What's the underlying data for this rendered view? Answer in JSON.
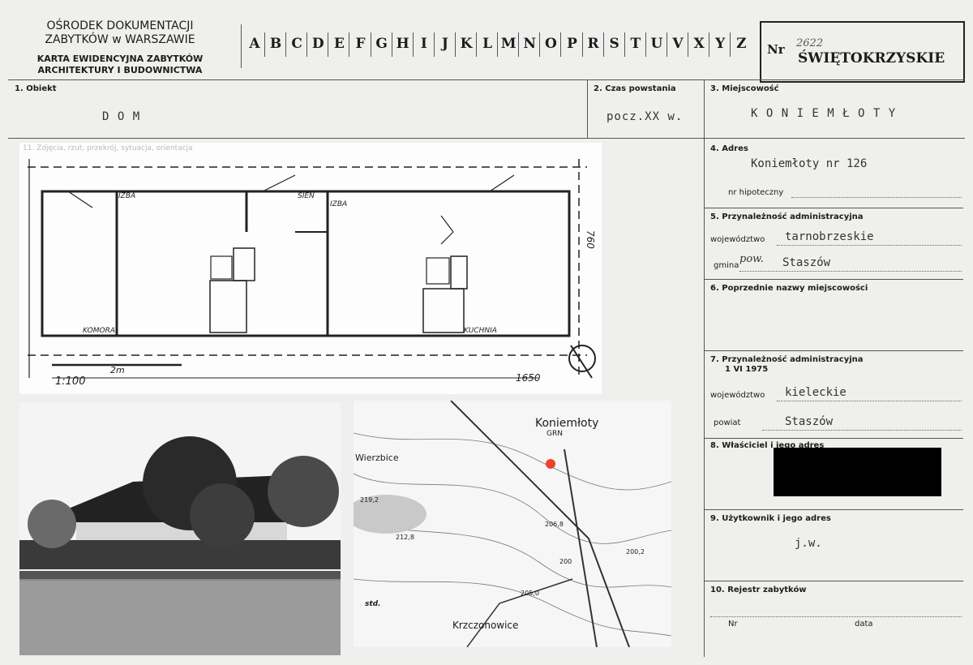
{
  "header": {
    "institution_line1": "OŚRODEK DOKUMENTACJI",
    "institution_line2": "ZABYTKÓW w WARSZAWIE",
    "card_line1": "KARTA EWIDENCYJNA ZABYTKÓW",
    "card_line2": "ARCHITEKTURY I BUDOWNICTWA",
    "letters": [
      "A",
      "B",
      "C",
      "D",
      "E",
      "F",
      "G",
      "H",
      "I",
      "J",
      "K",
      "L",
      "M",
      "N",
      "O",
      "P",
      "R",
      "S",
      "T",
      "U",
      "V",
      "X",
      "Y",
      "Z"
    ],
    "nr_label": "Nr",
    "nr_value": "2622",
    "region": "ŚWIĘTOKRZYSKIE"
  },
  "fields": {
    "obiekt_label": "1. Obiekt",
    "obiekt_value": "D O M",
    "czas_label": "2. Czas powstania",
    "czas_value": "pocz.XX w.",
    "miejscowosc_label": "3. Miejscowość",
    "miejscowosc_value": "K O N I E M Ł O T Y",
    "adres_label": "4. Adres",
    "adres_value": "Koniemłoty nr 126",
    "hipoteczny_label": "nr hipoteczny",
    "przynal_label": "5. Przynależność administracyjna",
    "woj_label": "województwo",
    "woj_value": "tarnobrzeskie",
    "gmina_label": "gmina",
    "gmina_hand": "pow.",
    "gmina_value": "Staszów",
    "poprz_label": "6. Poprzednie nazwy miejscowości",
    "przynal75_label": "7. Przynależność administracyjna",
    "przynal75_date": "1 VI 1975",
    "woj75_label": "województwo",
    "woj75_value": "kieleckie",
    "powiat_label": "powiat",
    "powiat_value": "Staszów",
    "wlasciciel_label": "8. Właściciel i jego adres",
    "uzytkownik_label": "9. Użytkownik i jego adres",
    "uzytkownik_value": "j.w.",
    "rejestr_label": "10. Rejestr zabytków",
    "nr_label": "Nr",
    "data_label": "data",
    "plan_caption": "11. Zdjęcia, rzut, przekrój, sytuacja, orientacja"
  },
  "plan": {
    "labels": [
      "IZBA",
      "SIEŃ",
      "IZBA",
      "KOMORA",
      "KUCHNIA"
    ],
    "scale": "1:100",
    "dim_2m": "2m",
    "dim_total": "1650",
    "dim_depth": "760"
  },
  "map": {
    "place": "Koniemłoty",
    "grn": "GRN",
    "wierzbice": "Wierzbice",
    "krzczonowice": "Krzczonowice",
    "std": "std.",
    "elev": [
      "219,2",
      "212,8",
      "206,8",
      "205,0",
      "200",
      "200,2"
    ]
  }
}
